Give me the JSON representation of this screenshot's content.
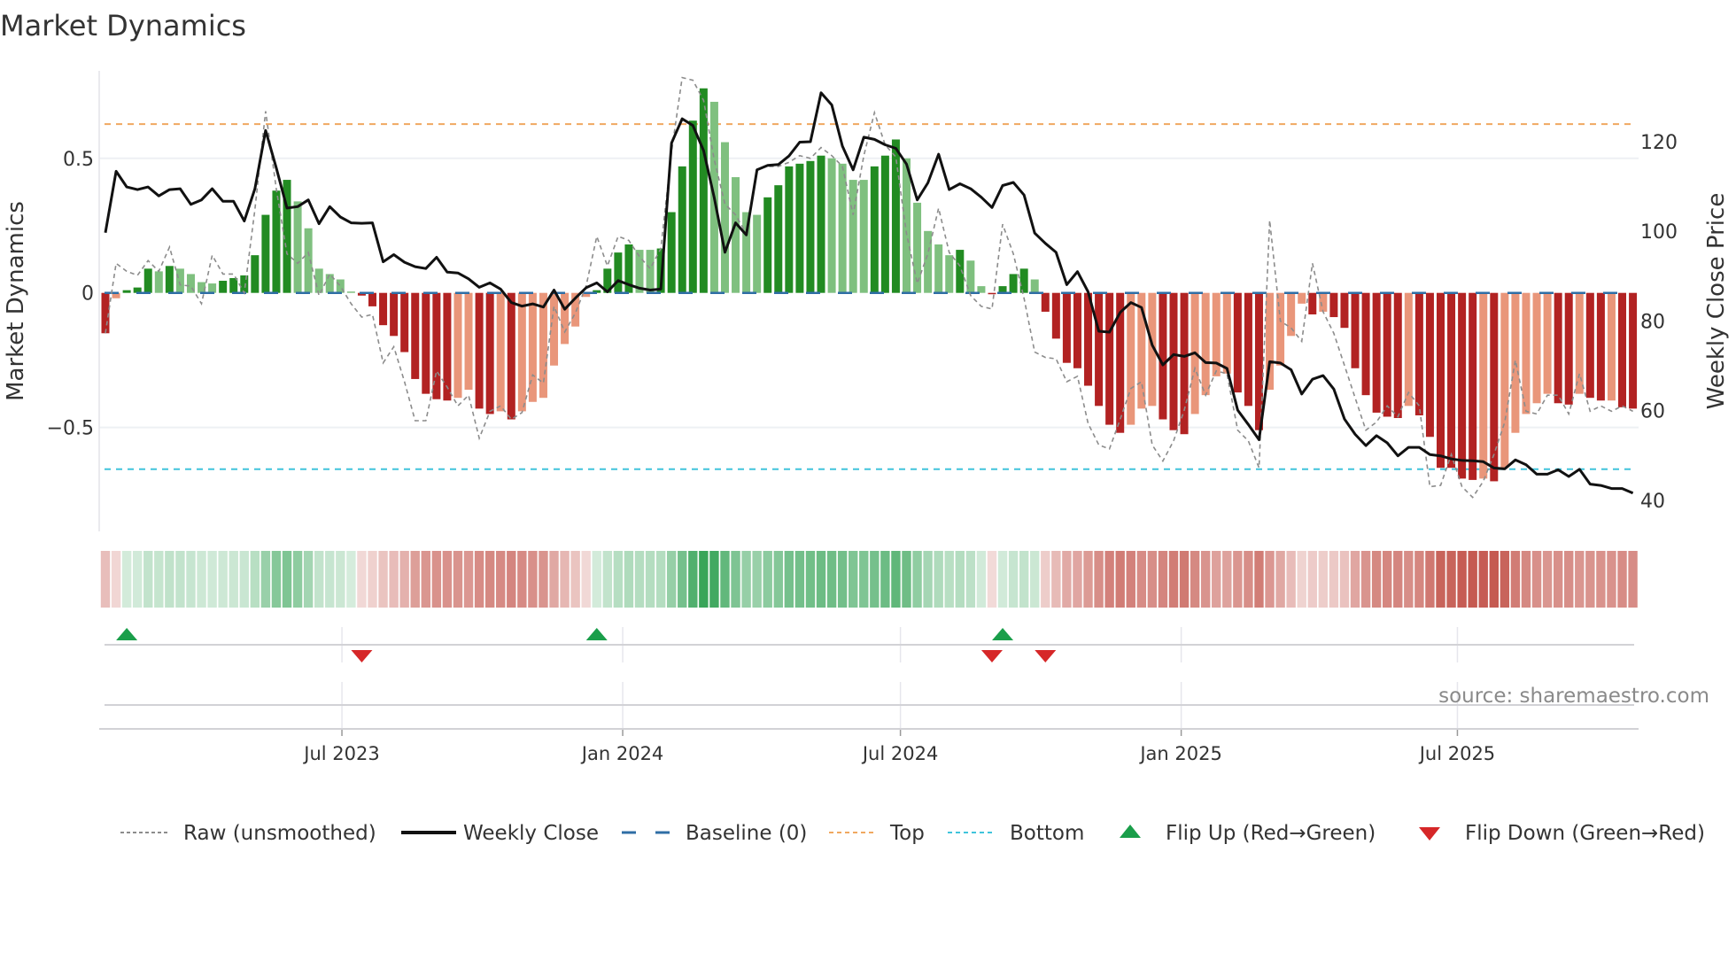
{
  "title": "Market Dynamics",
  "source": "source: sharemaestro.com",
  "legend": [
    {
      "key": "raw",
      "label": "Raw (unsmoothed)"
    },
    {
      "key": "close",
      "label": "Weekly Close"
    },
    {
      "key": "baseline",
      "label": "Baseline (0)"
    },
    {
      "key": "top",
      "label": "Top"
    },
    {
      "key": "bottom",
      "label": "Bottom"
    },
    {
      "key": "flip_up",
      "label": "Flip Up (Red→Green)"
    },
    {
      "key": "flip_down",
      "label": "Flip Down (Green→Red)"
    }
  ],
  "chart_data": {
    "type": "bar",
    "title": "Market Dynamics",
    "ylabel": "Market Dynamics",
    "y2label": "Weekly Close Price",
    "start_date": "2023-01-27",
    "frequency": "weekly",
    "ylim": [
      -0.827,
      0.825
    ],
    "y2lim": [
      36.6,
      135.8
    ],
    "yticks": [
      {
        "value": 0.5,
        "label": "0.5"
      },
      {
        "value": 0,
        "label": "0"
      },
      {
        "value": -0.5,
        "label": "−0.5"
      }
    ],
    "y2ticks": [
      {
        "value": 40,
        "label": "40"
      },
      {
        "value": 60,
        "label": "60"
      },
      {
        "value": 80,
        "label": "80"
      },
      {
        "value": 100,
        "label": "100"
      },
      {
        "value": 120,
        "label": "120"
      }
    ],
    "xticks": [
      {
        "date": "2023-07-01",
        "label": "Jul 2023"
      },
      {
        "date": "2024-01-01",
        "label": "Jan 2024"
      },
      {
        "date": "2024-07-01",
        "label": "Jul 2024"
      },
      {
        "date": "2025-01-01",
        "label": "Jan 2025"
      },
      {
        "date": "2025-07-01",
        "label": "Jul 2025"
      }
    ],
    "top": 0.627,
    "bottom": -0.655,
    "baseline": 0,
    "values": [
      -0.15,
      -0.02,
      0.01,
      0.02,
      0.09,
      0.08,
      0.1,
      0.09,
      0.07,
      0.04,
      0.035,
      0.045,
      0.055,
      0.065,
      0.14,
      0.29,
      0.38,
      0.42,
      0.34,
      0.24,
      0.09,
      0.07,
      0.05,
      0.005,
      -0.01,
      -0.05,
      -0.12,
      -0.16,
      -0.22,
      -0.32,
      -0.375,
      -0.395,
      -0.4,
      -0.39,
      -0.36,
      -0.43,
      -0.45,
      -0.44,
      -0.47,
      -0.44,
      -0.405,
      -0.39,
      -0.27,
      -0.19,
      -0.125,
      -0.015,
      0.01,
      0.09,
      0.15,
      0.18,
      0.16,
      0.16,
      0.165,
      0.3,
      0.47,
      0.64,
      0.76,
      0.71,
      0.56,
      0.43,
      0.3,
      0.29,
      0.355,
      0.4,
      0.47,
      0.48,
      0.49,
      0.51,
      0.5,
      0.48,
      0.42,
      0.42,
      0.47,
      0.51,
      0.57,
      0.5,
      0.335,
      0.23,
      0.18,
      0.14,
      0.16,
      0.12,
      0.025,
      -0.005,
      0.025,
      0.07,
      0.09,
      0.05,
      -0.07,
      -0.17,
      -0.26,
      -0.28,
      -0.345,
      -0.42,
      -0.49,
      -0.52,
      -0.49,
      -0.43,
      -0.42,
      -0.47,
      -0.51,
      -0.525,
      -0.45,
      -0.38,
      -0.31,
      -0.3,
      -0.37,
      -0.42,
      -0.51,
      -0.36,
      -0.27,
      -0.16,
      -0.04,
      -0.08,
      -0.07,
      -0.09,
      -0.13,
      -0.28,
      -0.38,
      -0.445,
      -0.46,
      -0.465,
      -0.42,
      -0.455,
      -0.535,
      -0.65,
      -0.65,
      -0.69,
      -0.695,
      -0.69,
      -0.7,
      -0.65,
      -0.52,
      -0.45,
      -0.41,
      -0.375,
      -0.41,
      -0.415,
      -0.375,
      -0.39,
      -0.4,
      -0.4,
      -0.425,
      -0.43
    ],
    "shade": "DLDDDLDLLLLDDDDDDDLLLLLLDDDDDDDDDLLDDLDLLLLLLLDDDDLLDDDDDLLLLLDDDDDDLLLLDDDLLLLLDLLDDDDLDDDDDDDDLLLDDDLLLLDDDLLLLDLDDDDDDDLDDDDDDLDLLLLLDDLDDLDD",
    "raw": [
      -0.15,
      0.11,
      0.08,
      0.065,
      0.12,
      0.08,
      0.17,
      0.03,
      0.025,
      -0.04,
      0.14,
      0.07,
      0.07,
      0,
      0.31,
      0.675,
      0.385,
      0.145,
      0.11,
      0.15,
      -0.01,
      0.07,
      0.025,
      -0.04,
      -0.09,
      -0.08,
      -0.26,
      -0.2,
      -0.33,
      -0.475,
      -0.475,
      -0.29,
      -0.35,
      -0.42,
      -0.38,
      -0.54,
      -0.44,
      -0.42,
      -0.47,
      -0.445,
      -0.305,
      -0.335,
      -0.05,
      -0.145,
      -0.075,
      0.025,
      0.21,
      0.1,
      0.21,
      0.195,
      0.135,
      0.09,
      0.165,
      0.525,
      0.8,
      0.79,
      0.715,
      0.495,
      0.33,
      0.29,
      0.22,
      0.46,
      0.47,
      0.47,
      0.485,
      0.51,
      0.5,
      0.54,
      0.51,
      0.47,
      0.29,
      0.51,
      0.67,
      0.55,
      0.505,
      0.22,
      0.035,
      0.145,
      0.315,
      0.15,
      0.1,
      -0.01,
      -0.05,
      -0.06,
      0.255,
      0.145,
      -0.02,
      -0.22,
      -0.24,
      -0.245,
      -0.33,
      -0.31,
      -0.485,
      -0.565,
      -0.58,
      -0.47,
      -0.355,
      -0.33,
      -0.565,
      -0.625,
      -0.55,
      -0.435,
      -0.28,
      -0.38,
      -0.29,
      -0.3,
      -0.51,
      -0.55,
      -0.65,
      0.27,
      -0.105,
      -0.13,
      -0.18,
      0.11,
      -0.07,
      -0.15,
      -0.27,
      -0.39,
      -0.51,
      -0.48,
      -0.42,
      -0.46,
      -0.37,
      -0.42,
      -0.72,
      -0.715,
      -0.6,
      -0.72,
      -0.76,
      -0.7,
      -0.6,
      -0.48,
      -0.25,
      -0.44,
      -0.45,
      -0.38,
      -0.38,
      -0.45,
      -0.3,
      -0.44,
      -0.42,
      -0.44,
      -0.42,
      -0.44
    ],
    "close": [
      99.7,
      113.4,
      109.9,
      109.3,
      109.9,
      107.9,
      109.3,
      109.5,
      106,
      107,
      109.5,
      106.7,
      106.7,
      102.3,
      109.5,
      122.5,
      114.1,
      105.2,
      105.5,
      107,
      101.7,
      105.5,
      103.2,
      101.9,
      101.8,
      101.9,
      93.2,
      94.8,
      93.1,
      92.1,
      91.7,
      94.2,
      90.9,
      90.7,
      89.4,
      87.5,
      88.5,
      87.1,
      84.1,
      83.3,
      83.8,
      83.1,
      86.9,
      82.6,
      85.1,
      87.4,
      88.5,
      86.5,
      89,
      88.1,
      87.3,
      86.9,
      87.1,
      119.7,
      125.1,
      123.6,
      118,
      107.5,
      95.3,
      101.9,
      99.2,
      113.7,
      114.7,
      114.9,
      116.8,
      119.9,
      120,
      130.9,
      128.2,
      119,
      113.7,
      121,
      120.5,
      119.3,
      118.5,
      115,
      107,
      110.8,
      117.2,
      109.3,
      110.6,
      109.5,
      107.6,
      105.3,
      110.2,
      110.9,
      108.1,
      99.6,
      97.3,
      95.3,
      88.1,
      91,
      86.5,
      77.7,
      77.5,
      81.9,
      84.1,
      83,
      74.6,
      70.2,
      72.5,
      72.1,
      72.9,
      70.7,
      70.6,
      69.4,
      60.1,
      56.9,
      53.5,
      70.9,
      70.6,
      69.1,
      63.7,
      67,
      67.8,
      64.8,
      58.1,
      54.7,
      52.2,
      54.4,
      52.8,
      49.9,
      51.8,
      51.8,
      50.2,
      49.9,
      49.2,
      48.9,
      48.8,
      48.6,
      47.2,
      47,
      49,
      47.9,
      45.8,
      45.8,
      46.8,
      45.3,
      46.9,
      43.6,
      43.3,
      42.6,
      42.6,
      41.6
    ],
    "flips": [
      {
        "date": "2023-02-10",
        "direction": "up"
      },
      {
        "date": "2023-07-14",
        "direction": "down"
      },
      {
        "date": "2023-12-15",
        "direction": "up"
      },
      {
        "date": "2024-08-30",
        "direction": "down"
      },
      {
        "date": "2024-09-06",
        "direction": "up"
      },
      {
        "date": "2024-10-04",
        "direction": "down"
      }
    ],
    "colors": {
      "green_dark": "#228b22",
      "green_light": "#7fc07f",
      "red_dark": "#b22222",
      "red_light": "#e9967a",
      "close": "#111111",
      "raw": "#8c8c8c",
      "baseline": "#2f6ea5",
      "top": "#f0a860",
      "bottom": "#40c4dc",
      "flip_up": "#1a9e4a",
      "flip_down": "#d62728",
      "strip_green": "#2ea050",
      "strip_red": "#be463c"
    }
  }
}
